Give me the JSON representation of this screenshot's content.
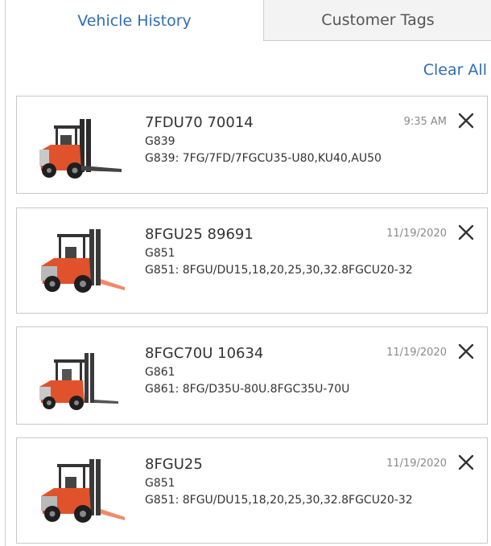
{
  "tabs": {
    "vehicle_history": "Vehicle History",
    "customer_tags": "Customer Tags"
  },
  "actions": {
    "clear_all": "Clear All"
  },
  "colors": {
    "accent": "#2f6db3",
    "forklift_body": "#e0522b",
    "forklift_dark": "#2b2b2b"
  },
  "items": [
    {
      "model": "7FDU70 70014",
      "code": "G839",
      "description": "G839: 7FG/7FD/7FGCU35-U80,KU40,AU50",
      "time": "9:35 AM",
      "image": "large-forklift-image"
    },
    {
      "model": "8FGU25 89691",
      "code": "G851",
      "description": "G851: 8FGU/DU15,18,20,25,30,32.8FGCU20-32",
      "time": "11/19/2020",
      "image": "forklift-image"
    },
    {
      "model": "8FGC70U 10634",
      "code": "G861",
      "description": "G861: 8FG/D35U-80U.8FGC35U-70U",
      "time": "11/19/2020",
      "image": "small-forklift-image"
    },
    {
      "model": "8FGU25",
      "code": "G851",
      "description": "G851: 8FGU/DU15,18,20,25,30,32.8FGCU20-32",
      "time": "11/19/2020",
      "image": "forklift-image"
    }
  ]
}
